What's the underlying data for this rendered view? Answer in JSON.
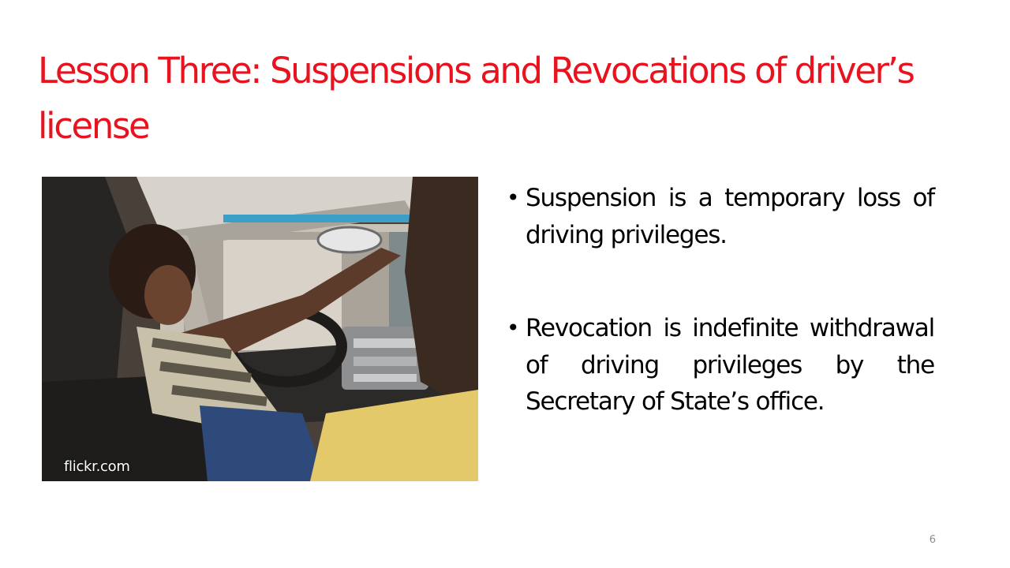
{
  "slide": {
    "title": "Lesson Three: Suspensions and Revocations of driver’s license",
    "photo_credit": "flickr.com",
    "bullet_glyph": "•",
    "bullets": [
      {
        "text": "Suspension is a temporary loss of driving privileges."
      },
      {
        "text": "Revocation is indefinite withdrawal of driving privileges by the Secretary of State’s office."
      }
    ],
    "page_number": "6",
    "colors": {
      "title": "#e8131f",
      "body_text": "#000000",
      "page_number": "#8c8c8c",
      "background": "#ffffff"
    }
  }
}
